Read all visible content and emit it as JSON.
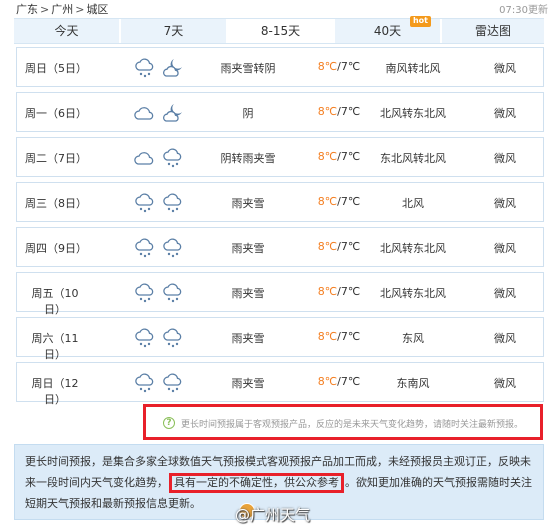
{
  "breadcrumb": {
    "province": "广东",
    "sep1": ">",
    "city": "广州",
    "sep2": ">",
    "district": "城区"
  },
  "updated": "07:30更新",
  "tabs": [
    {
      "label": "今天",
      "active": false
    },
    {
      "label": "7天",
      "active": false
    },
    {
      "label": "8-15天",
      "active": true
    },
    {
      "label": "40天",
      "active": false,
      "badge": "hot"
    },
    {
      "label": "雷达图",
      "active": false
    }
  ],
  "days": [
    {
      "name": "周日（5日）",
      "icons": [
        "rain-snow-icon",
        "partly-cloudy-night-icon"
      ],
      "weather": "雨夹雪转阴",
      "hi": "8℃",
      "lo": "7℃",
      "wind": "南风转北风",
      "level": "微风"
    },
    {
      "name": "周一（6日）",
      "icons": [
        "cloudy-icon",
        "partly-cloudy-night-icon"
      ],
      "weather": "阴",
      "hi": "8℃",
      "lo": "7℃",
      "wind": "北风转东北风",
      "level": "微风"
    },
    {
      "name": "周二（7日）",
      "icons": [
        "cloudy-icon",
        "rain-snow-icon"
      ],
      "weather": "阴转雨夹雪",
      "hi": "8℃",
      "lo": "7℃",
      "wind": "东北风转北风",
      "level": "微风"
    },
    {
      "name": "周三（8日）",
      "icons": [
        "rain-snow-icon",
        "rain-snow-icon"
      ],
      "weather": "雨夹雪",
      "hi": "8℃",
      "lo": "7℃",
      "wind": "北风",
      "level": "微风"
    },
    {
      "name": "周四（9日）",
      "icons": [
        "rain-snow-icon",
        "rain-snow-icon"
      ],
      "weather": "雨夹雪",
      "hi": "8℃",
      "lo": "7℃",
      "wind": "北风转东北风",
      "level": "微风"
    },
    {
      "name": "周五（10日）",
      "icons": [
        "rain-snow-icon",
        "rain-snow-icon"
      ],
      "weather": "雨夹雪",
      "hi": "8℃",
      "lo": "7℃",
      "wind": "北风转东北风",
      "level": "微风"
    },
    {
      "name": "周六（11日）",
      "icons": [
        "rain-snow-icon",
        "rain-snow-icon"
      ],
      "weather": "雨夹雪",
      "hi": "8℃",
      "lo": "7℃",
      "wind": "东风",
      "level": "微风"
    },
    {
      "name": "周日（12日）",
      "icons": [
        "rain-snow-icon",
        "rain-snow-icon"
      ],
      "weather": "雨夹雪",
      "hi": "8℃",
      "lo": "7℃",
      "wind": "东南风",
      "level": "微风"
    }
  ],
  "temp_sep": "/",
  "note": {
    "icon": "?",
    "text": "更长时间预报属于客观预报产品，反应的是未来天气变化趋势，请随时关注最新预报。"
  },
  "info": {
    "part1": "更长时间预报，是集合多家全球数值天气预报模式客观预报产品加工而成，未经预报员主观订正，反映未来一段时间内天气变化趋势，",
    "highlight": "具有一定的不确定性，供公众参考",
    "part2": "。欲知更加准确的天气预报需随时关注短期天气预报和最新预报信息更新。"
  },
  "watermark": "@广州天气",
  "colors": {
    "tab_bg": "#eaf3fb",
    "high_temp": "#f47f22",
    "highlight_border": "#e8202a",
    "info_bg": "#dcebf8"
  }
}
